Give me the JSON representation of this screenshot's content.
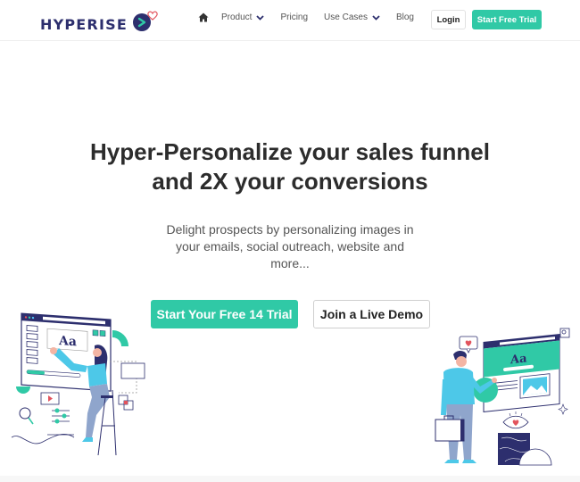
{
  "brand": {
    "name": "HYPERISE",
    "primary_color": "#30c9a6",
    "navy_color": "#2d2f6e",
    "heart_color": "#e2545d"
  },
  "nav": {
    "home_icon": "home-icon",
    "items": [
      {
        "label": "Product",
        "has_dropdown": true
      },
      {
        "label": "Pricing",
        "has_dropdown": false
      },
      {
        "label": "Use Cases",
        "has_dropdown": true
      },
      {
        "label": "Blog",
        "has_dropdown": false
      }
    ],
    "login_label": "Login",
    "trial_label": "Start Free Trial"
  },
  "hero": {
    "title_line1": "Hyper-Personalize your sales funnel",
    "title_line2": "and 2X your conversions",
    "subtitle": "Delight prospects by personalizing images in your emails, social outreach, website and more...",
    "cta_primary": "Start Your Free 14 Trial",
    "cta_secondary": "Join a Live Demo"
  },
  "illustrations": {
    "left": {
      "label": "woman-editing-web-page-illustration",
      "sample_text": "Aa"
    },
    "right": {
      "label": "man-presenting-web-page-illustration",
      "sample_text": "Aa"
    }
  }
}
